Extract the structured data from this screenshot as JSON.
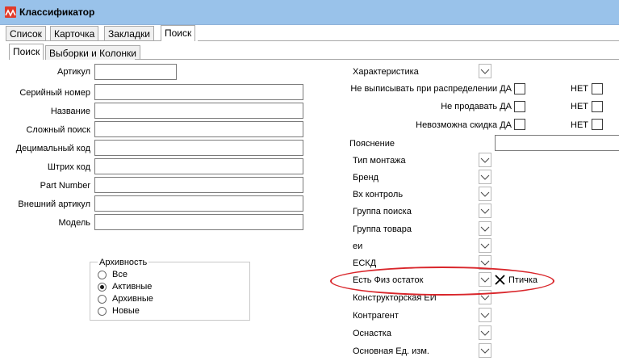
{
  "window": {
    "title": "Классификатор"
  },
  "main_tabs": [
    {
      "label": "Список"
    },
    {
      "label": "Карточка"
    },
    {
      "label": "Закладки"
    },
    {
      "label": "Поиск"
    }
  ],
  "sub_tabs": [
    {
      "label": "Поиск"
    },
    {
      "label": "Выборки и Колонки"
    }
  ],
  "fields": [
    {
      "label": "Артикул",
      "value": ""
    },
    {
      "label": "Серийный номер",
      "value": ""
    },
    {
      "label": "Название",
      "value": ""
    },
    {
      "label": "Сложный поиск",
      "value": ""
    },
    {
      "label": "Децимальный код",
      "value": ""
    },
    {
      "label": "Штрих код",
      "value": ""
    },
    {
      "label": "Part Number",
      "value": ""
    },
    {
      "label": "Внешний артикул",
      "value": ""
    },
    {
      "label": "Модель",
      "value": ""
    }
  ],
  "archive": {
    "title": "Архивность",
    "options": [
      {
        "label": "Все",
        "selected": false
      },
      {
        "label": "Активные",
        "selected": true
      },
      {
        "label": "Архивные",
        "selected": false
      },
      {
        "label": "Новые",
        "selected": false
      }
    ]
  },
  "right": {
    "characteristic": "Характеристика",
    "flags": [
      {
        "label": "Не выписывать при распределении ДА",
        "no": "НЕТ"
      },
      {
        "label": "Не продавать ДА",
        "no": "НЕТ"
      },
      {
        "label": "Невозможна скидка ДА",
        "no": "НЕТ"
      }
    ],
    "explanation": "Пояснение",
    "dropdowns": [
      {
        "label": "Тип монтажа"
      },
      {
        "label": "Бренд"
      },
      {
        "label": "Вх контроль"
      },
      {
        "label": "Группа поиска"
      },
      {
        "label": "Группа товара"
      },
      {
        "label": "еи"
      },
      {
        "label": "ЕСКД"
      },
      {
        "label": "Есть Физ остаток"
      },
      {
        "label": "Конструкторская ЕИ"
      },
      {
        "label": "Контрагент"
      },
      {
        "label": "Оснастка"
      },
      {
        "label": "Основная Ед. изм."
      }
    ],
    "annotation": "Птичка"
  }
}
